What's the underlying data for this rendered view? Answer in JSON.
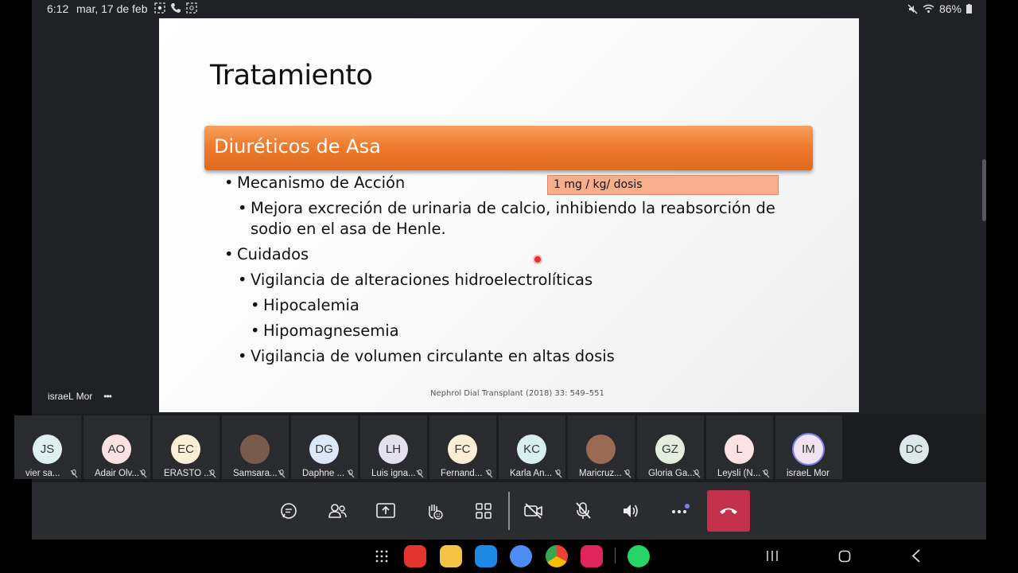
{
  "status_bar": {
    "time": "6:12",
    "date": "mar, 17 de feb",
    "battery": "86%"
  },
  "slide": {
    "title": "Tratamiento",
    "section_title": "Diuréticos de Asa",
    "dose_box": "1 mg / kg/ dosis",
    "bullets": {
      "mechanism": "Mecanismo de Acción",
      "mechanism_detail_1": "Mejora excreción de urinaria de calcio, inhibiendo la reabsorción de",
      "mechanism_detail_2": "sodio en el asa de Henle.",
      "care": "Cuidados",
      "care_1": "Vigilancia de alteraciones hidroelectrolíticas",
      "care_1a": "Hipocalemia",
      "care_1b": "Hipomagnesemia",
      "care_2": "Vigilancia de volumen circulante en altas dosis"
    },
    "citation": "Nephrol Dial Transplant (2018) 33: 549–551",
    "bullet_glyph": "•"
  },
  "presenter": {
    "name": "israeL Mor",
    "more": "•••"
  },
  "participants": [
    {
      "initials": "JS",
      "name": "vier sa...",
      "color": "#dff0f3"
    },
    {
      "initials": "AO",
      "name": "Adair Olv...",
      "color": "#fde2e4"
    },
    {
      "initials": "EC",
      "name": "ERASTO ...",
      "color": "#fcefd5"
    },
    {
      "initials": "",
      "name": "Samsara...",
      "color": "#7a5a4a"
    },
    {
      "initials": "DG",
      "name": "Daphne ...",
      "color": "#dce8f7"
    },
    {
      "initials": "LH",
      "name": "Luis igna...",
      "color": "#e4e0ee"
    },
    {
      "initials": "FC",
      "name": "Fernand...",
      "color": "#fcefd5"
    },
    {
      "initials": "KC",
      "name": "Karla An...",
      "color": "#d9eeee"
    },
    {
      "initials": "",
      "name": "Maricruz...",
      "color": "#9a6a55"
    },
    {
      "initials": "GZ",
      "name": "Gloria Ga...",
      "color": "#e4eedf"
    },
    {
      "initials": "L",
      "name": "Leysli (N...",
      "color": "#fde2e4"
    },
    {
      "initials": "IM",
      "name": "israeL Mor",
      "color": "#f1e3f0"
    }
  ],
  "extra_participant": {
    "initials": "DC",
    "color": "#dde8ea"
  }
}
